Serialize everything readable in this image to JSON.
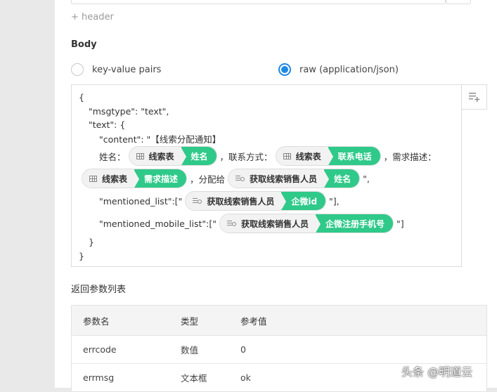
{
  "header": {
    "add_header_label": "+ header"
  },
  "body": {
    "title": "Body",
    "options": [
      {
        "label": "key-value pairs",
        "checked": false
      },
      {
        "label": "raw (application/json)",
        "checked": true
      }
    ]
  },
  "editor": {
    "l1": "{",
    "l2": "\"msgtype\": \"text\",",
    "l3": "\"text\": {",
    "l4": "\"content\": \"【线索分配通知】",
    "l5_a": "姓名：",
    "l5_t1_src": "线索表",
    "l5_t1_field": "姓名",
    "l5_b": "，联系方式：",
    "l5_t2_src": "线索表",
    "l5_t2_field": "联系电话",
    "l5_c": "，需求描述：",
    "l6_t1_src": "线索表",
    "l6_t1_field": "需求描述",
    "l6_a": "，分配给",
    "l6_t2_src": "获取线索销售人员",
    "l6_t2_field": "姓名",
    "l6_b": "\",",
    "l7_a": "\"mentioned_list\":[\"",
    "l7_t_src": "获取线索销售人员",
    "l7_t_field": "企微id",
    "l7_b": "\"],",
    "l8_a": "\"mentioned_mobile_list\":[\"",
    "l8_t_src": "获取线索销售人员",
    "l8_t_field": "企微注册手机号",
    "l8_b": "\"]",
    "l9": "}",
    "l10": "}"
  },
  "return_params": {
    "title": "返回参数列表",
    "columns": [
      "参数名",
      "类型",
      "参考值"
    ],
    "rows": [
      [
        "errcode",
        "数值",
        "0"
      ],
      [
        "errmsg",
        "文本框",
        "ok"
      ]
    ]
  },
  "watermark": "头条 @明道云"
}
